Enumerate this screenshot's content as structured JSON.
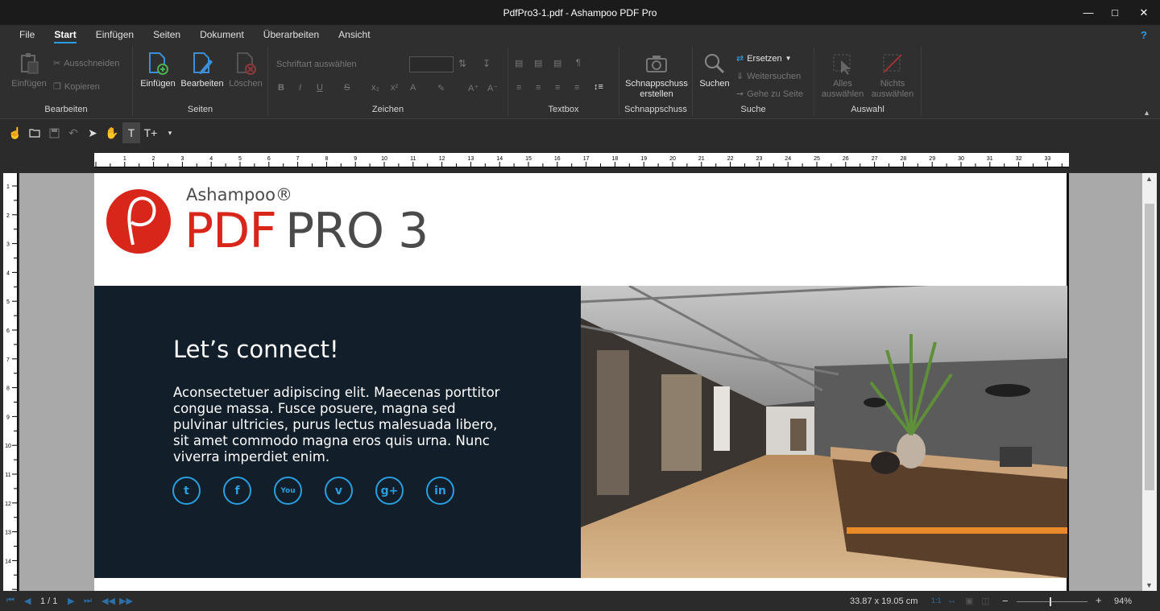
{
  "window": {
    "title": "PdfPro3-1.pdf - Ashampoo PDF Pro"
  },
  "menu": {
    "items": [
      "File",
      "Start",
      "Einfügen",
      "Seiten",
      "Dokument",
      "Überarbeiten",
      "Ansicht"
    ],
    "active": "Start",
    "help": "?"
  },
  "ribbon": {
    "bearbeiten": {
      "label": "Bearbeiten",
      "einfuegen": "Einfügen",
      "ausschneiden": "Ausschneiden",
      "kopieren": "Kopieren"
    },
    "seiten": {
      "label": "Seiten",
      "einfuegen": "Einfügen",
      "bearbeiten": "Bearbeiten",
      "loeschen": "Löschen"
    },
    "zeichen": {
      "label": "Zeichen",
      "font_placeholder": "Schriftart auswählen"
    },
    "textbox": {
      "label": "Textbox"
    },
    "schnappschuss": {
      "label": "Schnappschuss",
      "button_line1": "Schnappschuss",
      "button_line2": "erstellen"
    },
    "suche": {
      "label": "Suche",
      "suchen": "Suchen",
      "ersetzen": "Ersetzen",
      "weitersuchen": "Weitersuchen",
      "gehe_zu_seite": "Gehe zu Seite"
    },
    "auswahl": {
      "label": "Auswahl",
      "alles_line1": "Alles",
      "alles_line2": "auswählen",
      "nichts_line1": "Nichts",
      "nichts_line2": "auswählen"
    }
  },
  "ruler": {
    "h_labels": [
      "1",
      "2",
      "3",
      "4",
      "5",
      "6",
      "7",
      "8",
      "9",
      "10",
      "11",
      "12",
      "13",
      "14",
      "15",
      "16",
      "17",
      "18",
      "19",
      "20",
      "21",
      "22",
      "23",
      "24",
      "25",
      "26",
      "27",
      "28",
      "29",
      "30",
      "31",
      "32",
      "33"
    ],
    "v_labels": [
      "1",
      "2",
      "3",
      "4",
      "5",
      "6",
      "7",
      "8",
      "9",
      "10",
      "11",
      "12",
      "13",
      "14"
    ]
  },
  "document": {
    "logo_brand": "Ashampoo®",
    "logo_pdf": "PDF",
    "logo_pro": "PRO 3",
    "headline": "Let’s connect!",
    "body": "Aconsectetuer adipiscing elit. Maecenas porttitor congue massa. Fusce posuere, magna sed pulvinar ultricies, purus lectus malesuada libero, sit amet commodo magna eros quis urna. Nunc viverra imperdiet enim.",
    "social_icons": [
      {
        "name": "twitter-icon",
        "glyph": "t"
      },
      {
        "name": "facebook-icon",
        "glyph": "f"
      },
      {
        "name": "youtube-icon",
        "glyph": "You"
      },
      {
        "name": "vimeo-icon",
        "glyph": "v"
      },
      {
        "name": "google-plus-icon",
        "glyph": "g+"
      },
      {
        "name": "linkedin-icon",
        "glyph": "in"
      }
    ]
  },
  "status": {
    "page": "1 / 1",
    "dimensions": "33.87 x 19.05 cm",
    "zoom": "94%",
    "zoom_level": 0.94
  },
  "colors": {
    "accent": "#2d9ee6",
    "logo_red": "#d8261b",
    "panel_dark": "#121e29"
  }
}
